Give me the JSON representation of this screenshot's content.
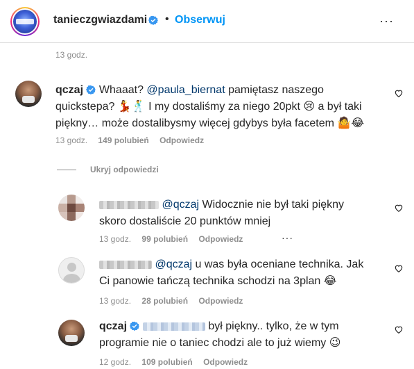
{
  "header": {
    "username": "tanieczgwiazdami",
    "separator": "•",
    "follow_label": "Obserwuj",
    "more": "···"
  },
  "previous_comment": {
    "time": "13 godz."
  },
  "comment": {
    "username": "qczaj",
    "text_before": "Whaaat?",
    "mention": "@paula_biernat",
    "line1_rest": "pamiętasz naszego",
    "line2": "quickstepa? 💃🕺 I my dostaliśmy za niego 20pkt 😢 a był taki",
    "line3": "piękny… może dostalibysmy więcej gdybys była facetem 🤷😂",
    "time": "13 godz.",
    "likes": "149 polubień",
    "reply_label": "Odpowiedz"
  },
  "hide_replies_label": "Ukryj odpowiedzi",
  "replies": [
    {
      "mention": "@qczaj",
      "line1": "Widocznie nie był taki piękny",
      "line2": "skoro dostaliście 20 punktów mniej",
      "time": "13 godz.",
      "likes": "99 polubień",
      "reply_label": "Odpowiedz",
      "more": "···"
    },
    {
      "mention": "@qczaj",
      "line1": "u was była oceniane technika. Jak",
      "line2": "Ci panowie tańczą technika schodzi na 3plan 😂",
      "time": "13 godz.",
      "likes": "28 polubień",
      "reply_label": "Odpowiedz"
    },
    {
      "username": "qczaj",
      "line1": "był piękny.. tylko, że w tym",
      "line2": "programie nie o taniec chodzi ale to już wiemy 😉",
      "time": "12 godz.",
      "likes": "109 polubień",
      "reply_label": "Odpowiedz"
    }
  ],
  "colors": {
    "text": "#262626",
    "meta": "#8e8e8e",
    "link": "#0095f6",
    "mention": "#00376b",
    "verified": "#3897f0"
  }
}
